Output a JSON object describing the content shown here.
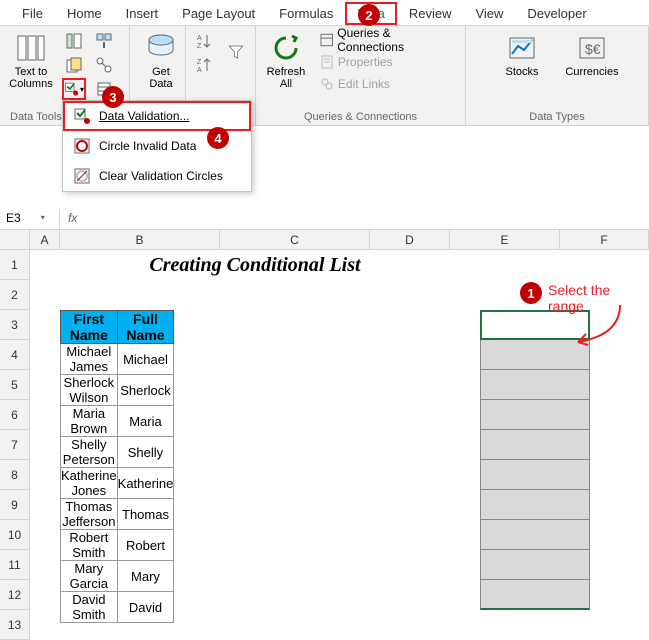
{
  "tabs": [
    "File",
    "Home",
    "Insert",
    "Page Layout",
    "Formulas",
    "Data",
    "Review",
    "View",
    "Developer"
  ],
  "active_tab": "Data",
  "ribbon": {
    "group_data_tools": "Data Tools",
    "group_queries": "Queries & Connections",
    "group_types": "Data Types",
    "text_to_columns": "Text to\nColumns",
    "get_data": "Get\nData",
    "refresh_all": "Refresh\nAll",
    "queries_conn": "Queries & Connections",
    "properties": "Properties",
    "edit_links": "Edit Links",
    "stocks": "Stocks",
    "currencies": "Currencies"
  },
  "dropdown": {
    "validation": "Data Validation...",
    "circle": "Circle Invalid Data",
    "clear": "Clear Validation Circles"
  },
  "namebox": "E3",
  "title": "Creating Conditional List",
  "headers": {
    "first": "First Name",
    "full": "Full Name"
  },
  "rows": [
    {
      "first": "Michael James",
      "full": "Michael"
    },
    {
      "first": "Sherlock Wilson",
      "full": "Sherlock"
    },
    {
      "first": "Maria Brown",
      "full": "Maria"
    },
    {
      "first": "Shelly Peterson",
      "full": "Shelly"
    },
    {
      "first": "Katherine Jones",
      "full": "Katherine"
    },
    {
      "first": "Thomas Jefferson",
      "full": "Thomas"
    },
    {
      "first": "Robert Smith",
      "full": "Robert"
    },
    {
      "first": "Mary Garcia",
      "full": "Mary"
    },
    {
      "first": "David Smith",
      "full": "David"
    }
  ],
  "rownums": [
    "1",
    "2",
    "3",
    "4",
    "5",
    "6",
    "7",
    "8",
    "9",
    "10",
    "11",
    "12",
    "13"
  ],
  "cols": {
    "A": "A",
    "B": "B",
    "C": "C",
    "D": "D",
    "E": "E",
    "F": "F"
  },
  "callouts": {
    "c1": "1",
    "c2": "2",
    "c3": "3",
    "c4": "4",
    "select_range": "Select the range"
  }
}
